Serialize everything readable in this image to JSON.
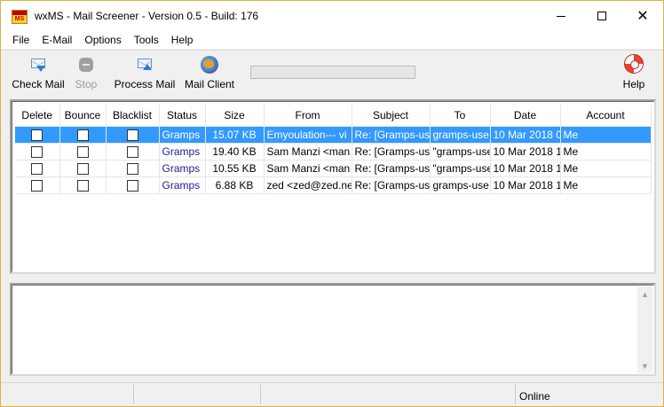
{
  "window": {
    "title": "wxMS - Mail Screener - Version 0.5 - Build: 176",
    "icon_text": "MS",
    "border_color": "#e0b040"
  },
  "menu": {
    "items": [
      "File",
      "E-Mail",
      "Options",
      "Tools",
      "Help"
    ]
  },
  "toolbar": {
    "check_mail": "Check Mail",
    "stop": "Stop",
    "process_mail": "Process Mail",
    "mail_client": "Mail Client",
    "help": "Help",
    "progress": 0
  },
  "table": {
    "columns": [
      "Delete",
      "Bounce",
      "Blacklist",
      "Status",
      "Size",
      "From",
      "Subject",
      "To",
      "Date",
      "Account"
    ],
    "rows": [
      {
        "delete": false,
        "bounce": false,
        "blacklist": false,
        "status": "Gramps",
        "size": "15.07 KB",
        "from": "Emyoulation--- vi",
        "subject": "Re: [Gramps-use",
        "to": "gramps-use",
        "date": "10 Mar 2018 0",
        "account": "Me",
        "selected": true
      },
      {
        "delete": false,
        "bounce": false,
        "blacklist": false,
        "status": "Gramps",
        "size": "19.40 KB",
        "from": "Sam Manzi <man",
        "subject": "Re: [Gramps-use",
        "to": "\"gramps-use",
        "date": "10 Mar 2018 1",
        "account": "Me",
        "selected": false
      },
      {
        "delete": false,
        "bounce": false,
        "blacklist": false,
        "status": "Gramps",
        "size": "10.55 KB",
        "from": "Sam Manzi <man",
        "subject": "Re: [Gramps-use",
        "to": "\"gramps-use",
        "date": "10 Mar 2018 1",
        "account": "Me",
        "selected": false
      },
      {
        "delete": false,
        "bounce": false,
        "blacklist": false,
        "status": "Gramps",
        "size": "6.88 KB",
        "from": "zed <zed@zed.net",
        "subject": "Re: [Gramps-use",
        "to": "gramps-use",
        "date": "10 Mar 2018 1",
        "account": "Me",
        "selected": false
      }
    ],
    "selection_color": "#3399ff",
    "status_color": "#2020a0"
  },
  "statusbar": {
    "field1": "",
    "field2": "",
    "field3": "",
    "online": "Online"
  }
}
